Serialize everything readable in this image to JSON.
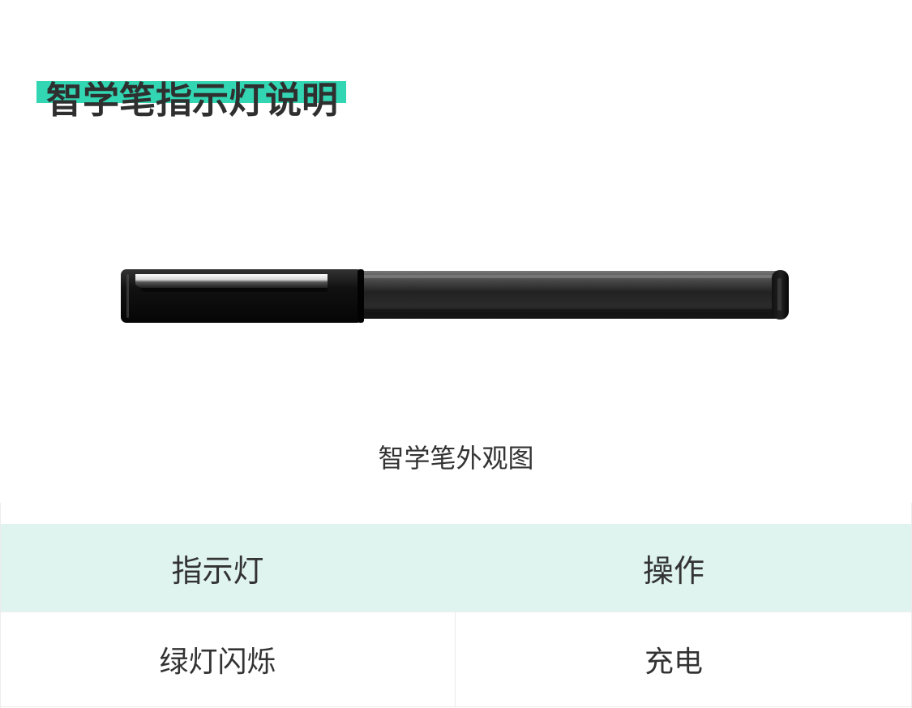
{
  "page": {
    "title": "智学笔指示灯说明",
    "figure_caption": "智学笔外观图"
  },
  "colors": {
    "accent": "#33d6b3",
    "table_header_bg": "#dff4ef",
    "text": "#333333"
  },
  "indicator_table": {
    "headers": [
      "指示灯",
      "操作"
    ],
    "rows": [
      [
        "绿灯闪烁",
        "充电"
      ]
    ]
  }
}
